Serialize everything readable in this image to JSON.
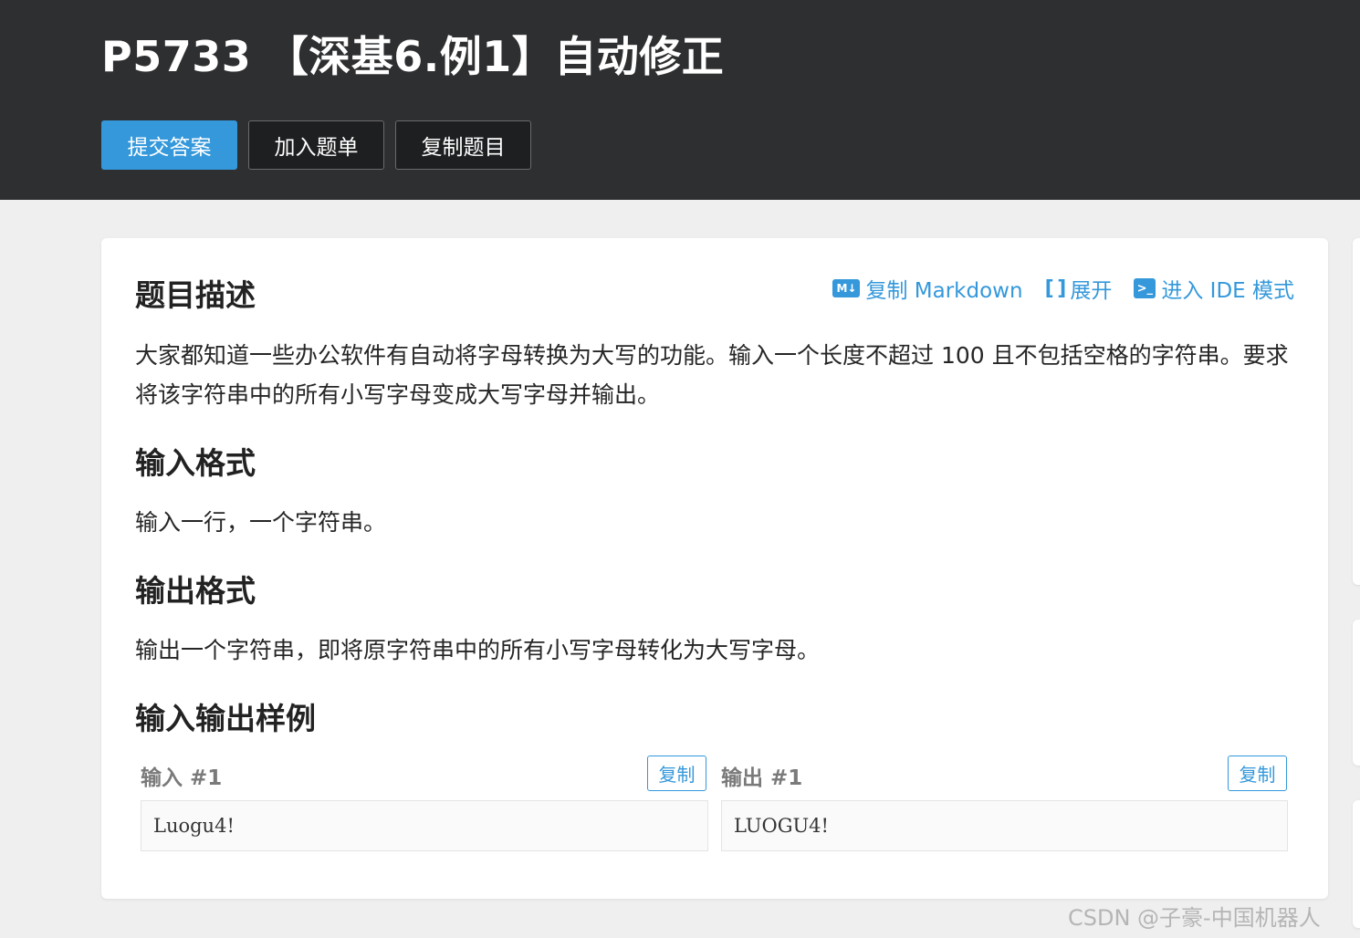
{
  "header": {
    "title": "P5733 【深基6.例1】自动修正",
    "buttons": [
      "提交答案",
      "加入题单",
      "复制题目"
    ]
  },
  "toolbar": {
    "copy_markdown": "复制 Markdown",
    "expand": "展开",
    "ide_mode": "进入 IDE 模式"
  },
  "sections": {
    "description_title": "题目描述",
    "description_text": "大家都知道一些办公软件有自动将字母转换为大写的功能。输入一个长度不超过 100 且不包括空格的字符串。要求将该字符串中的所有小写字母变成大写字母并输出。",
    "input_format_title": "输入格式",
    "input_format_text": "输入一行，一个字符串。",
    "output_format_title": "输出格式",
    "output_format_text": "输出一个字符串，即将原字符串中的所有小写字母转化为大写字母。",
    "samples_title": "输入输出样例"
  },
  "samples": {
    "input_label": "输入 #1",
    "output_label": "输出 #1",
    "copy_label": "复制",
    "input_value": "Luogu4!",
    "output_value": "LUOGU4!"
  },
  "watermark": "CSDN @子豪-中国机器人",
  "colors": {
    "header_bg": "#2e2f31",
    "accent": "#3498db",
    "page_bg": "#efefef"
  }
}
